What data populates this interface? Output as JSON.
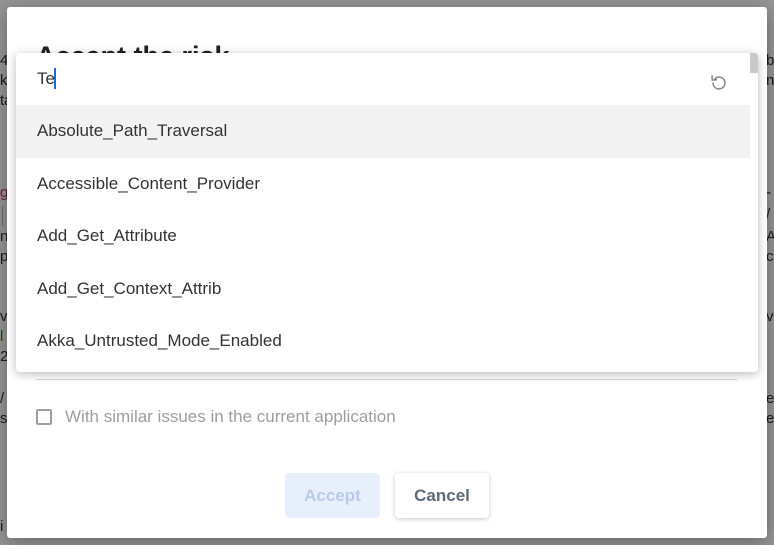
{
  "dialog": {
    "title": "Accept the risk"
  },
  "dropdown": {
    "search": {
      "value": "Te",
      "reset_icon": "refresh-icon"
    },
    "options": [
      "Absolute_Path_Traversal",
      "Accessible_Content_Provider",
      "Add_Get_Attribute",
      "Add_Get_Context_Attrib",
      "Akka_Untrusted_Mode_Enabled"
    ],
    "highlighted_index": 0,
    "scroll_position": 0
  },
  "checkbox": {
    "label": "With similar issues in the current application",
    "checked": false
  },
  "buttons": {
    "accept": "Accept",
    "cancel": "Cancel"
  },
  "colors": {
    "primary_disabled_bg": "#e7effb",
    "primary_disabled_text": "#b9cbe6",
    "caret": "#1a66d6"
  }
}
